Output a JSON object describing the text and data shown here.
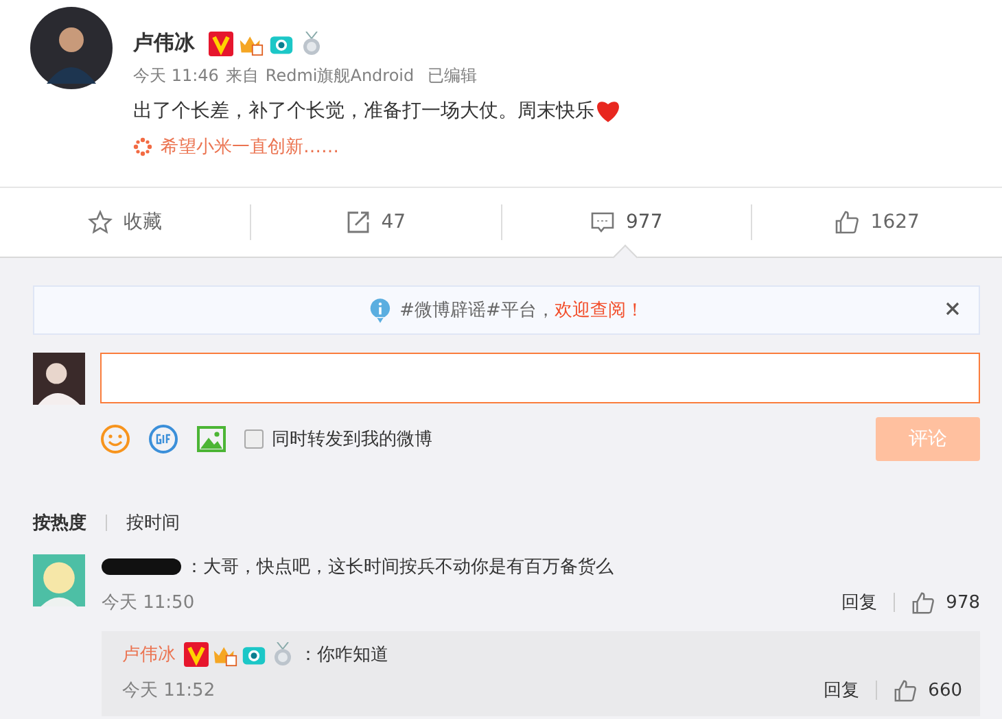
{
  "post": {
    "author": "卢伟冰",
    "time": "今天 11:46",
    "source_prefix": "来自",
    "source": "Redmi旗舰Android",
    "edited": "已编辑",
    "text": "出了个长差，补了个长觉，准备打一场大仗。周末快乐",
    "quote": "希望小米一直创新……"
  },
  "actions": [
    {
      "kind": "favorite",
      "label": "收藏",
      "selected": false
    },
    {
      "kind": "repost",
      "label": "47",
      "selected": false
    },
    {
      "kind": "comment",
      "label": "977",
      "selected": true
    },
    {
      "kind": "like",
      "label": "1627",
      "selected": false
    }
  ],
  "notice": {
    "text": "#微博辟谣#平台，",
    "link": "欢迎查阅！"
  },
  "composer": {
    "forward_label": "同时转发到我的微博",
    "forward_checked": false,
    "submit": "评论",
    "submit_disabled": true
  },
  "sort_tabs": [
    {
      "label": "按热度",
      "selected": true
    },
    {
      "label": "按时间",
      "selected": false
    }
  ],
  "comments": [
    {
      "name_redacted": true,
      "text": "：大哥，快点吧，这长时间按兵不动你是有百万备货么",
      "time": "今天 11:50",
      "reply": "回复",
      "likes": "978",
      "replies": [
        {
          "author": "卢伟冰",
          "text": "：你咋知道",
          "time": "今天 11:52",
          "reply": "回复",
          "likes": "660"
        }
      ]
    }
  ]
}
